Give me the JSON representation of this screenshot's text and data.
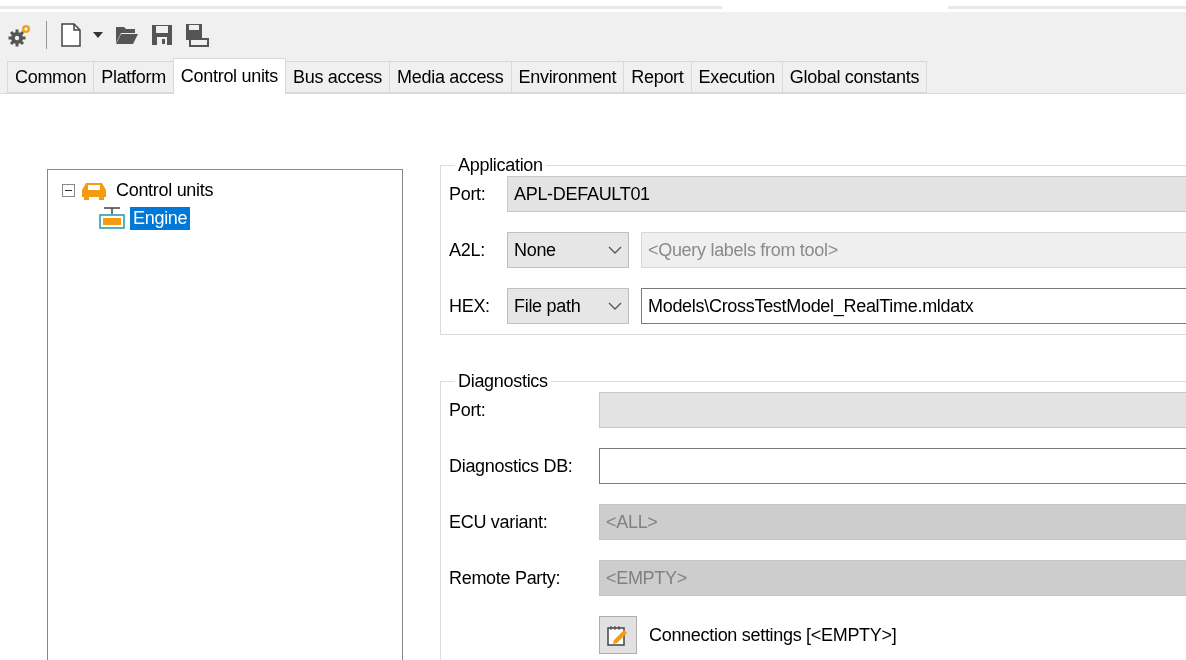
{
  "tabs": [
    {
      "label": "Common",
      "selected": false
    },
    {
      "label": "Platform",
      "selected": false
    },
    {
      "label": "Control units",
      "selected": true
    },
    {
      "label": "Bus access",
      "selected": false
    },
    {
      "label": "Media access",
      "selected": false
    },
    {
      "label": "Environment",
      "selected": false
    },
    {
      "label": "Report",
      "selected": false
    },
    {
      "label": "Execution",
      "selected": false
    },
    {
      "label": "Global constants",
      "selected": false
    }
  ],
  "tree": [
    {
      "label": "Control units",
      "expanded": true,
      "selected": false,
      "children": [
        {
          "label": "Engine",
          "selected": true
        }
      ]
    }
  ],
  "application": {
    "title": "Application",
    "rows": [
      {
        "label": "Port:",
        "field": {
          "kind": "readonly",
          "value": "APL-DEFAULT01"
        }
      },
      {
        "label": "A2L:",
        "select": "None",
        "field": {
          "kind": "disabled",
          "placeholder": "<Query labels from tool>"
        }
      },
      {
        "label": "HEX:",
        "select": "File path",
        "field": {
          "kind": "input",
          "value": "Models\\CrossTestModel_RealTime.mldatx"
        }
      }
    ]
  },
  "diagnostics": {
    "title": "Diagnostics",
    "rows": [
      {
        "label": "Port:",
        "field": {
          "kind": "readonly"
        }
      },
      {
        "label": "Diagnostics DB:",
        "field": {
          "kind": "input"
        }
      },
      {
        "label": "ECU variant:",
        "field": {
          "kind": "locked",
          "value": "<ALL>"
        }
      },
      {
        "label": "Remote Party:",
        "field": {
          "kind": "locked",
          "value": "<EMPTY>"
        }
      }
    ],
    "connection": "Connection settings [<EMPTY>]"
  }
}
